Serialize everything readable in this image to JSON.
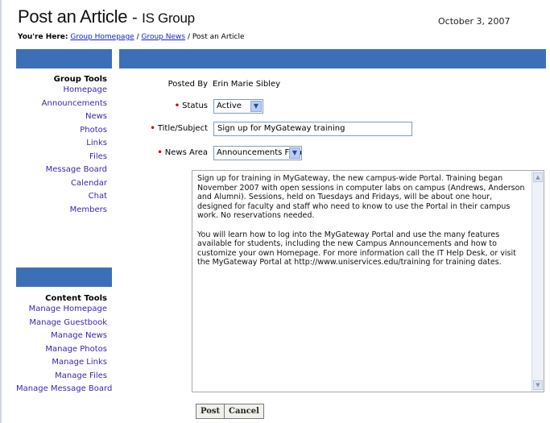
{
  "header": {
    "title": "Post an Article",
    "separator": "-",
    "group": "IS Group",
    "date": "October 3, 2007"
  },
  "breadcrumb": {
    "label": "You're Here:",
    "items": [
      "Group Homepage",
      "Group News",
      "Post an Article"
    ],
    "separator": "/"
  },
  "sidebar": {
    "group_tools": {
      "heading": "Group Tools",
      "items": [
        "Homepage",
        "Announcements",
        "News",
        "Photos",
        "Links",
        "Files",
        "Message Board",
        "Calendar",
        "Chat",
        "Members"
      ]
    },
    "content_tools": {
      "heading": "Content Tools",
      "items": [
        "Manage Homepage",
        "Manage Guestbook",
        "Manage News",
        "Manage Photos",
        "Manage Links",
        "Manage Files",
        "Manage Message Board"
      ]
    }
  },
  "form": {
    "posted_by_label": "Posted By",
    "posted_by_value": "Erin Marie Sibley",
    "status_label": "Status",
    "status_value": "Active",
    "title_label": "Title/Subject",
    "title_value": "Sign up for MyGateway training",
    "news_area_label": "News Area",
    "news_area_value": "Announcements Front",
    "body_paragraphs": [
      "Sign up for training in MyGateway, the new campus-wide Portal. Training began November 2007 with open sessions in computer labs on campus (Andrews, Anderson and Alumni). Sessions, held on Tuesdays and Fridays, will be about one hour, designed for faculty and staff who need to know to use the Portal in their campus work. No reservations needed.",
      "You will learn how to log into the MyGateway Portal and use the many features available for students, including the new Campus Announcements and how to customize your own Homepage. For more information call the IT Help Desk, or visit the MyGateway Portal at http://www.uniservices.edu/training for training dates."
    ],
    "post_button": "Post",
    "cancel_button": "Cancel"
  },
  "colors": {
    "bar_blue": "#3c6fb7",
    "link": "#3b1fb5",
    "required": "#d00000"
  }
}
